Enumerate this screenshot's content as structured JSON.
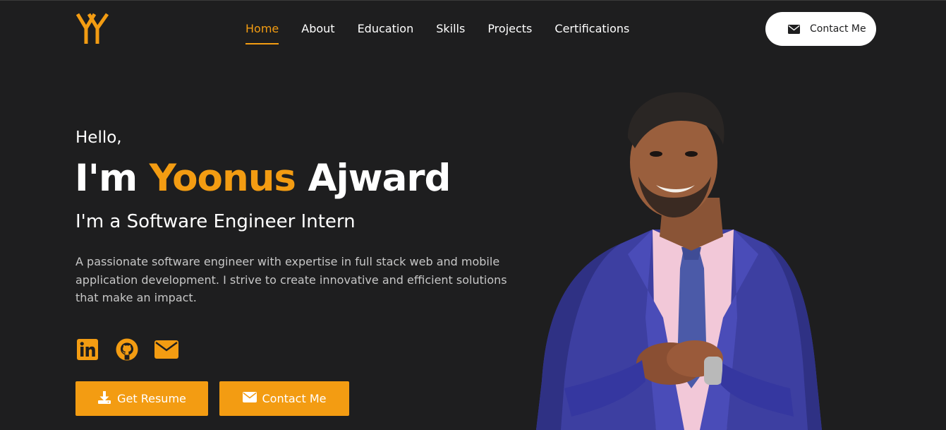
{
  "brand": {
    "logo_icon": "yy-monogram-logo-icon"
  },
  "nav": {
    "items": [
      {
        "label": "Home",
        "active": true
      },
      {
        "label": "About"
      },
      {
        "label": "Education"
      },
      {
        "label": "Skills"
      },
      {
        "label": "Projects"
      },
      {
        "label": "Certifications"
      }
    ],
    "contact_button": {
      "label": "Contact Me",
      "icon": "envelope-icon"
    }
  },
  "hero": {
    "greeting": "Hello,",
    "intro_prefix": "I'm",
    "first_name": "Yoonus",
    "last_name": "Ajward",
    "role": "I'm a Software Engineer Intern",
    "bio": "A passionate software engineer with expertise in full stack web and mobile application development. I strive to create innovative and efficient solutions that make an impact.",
    "socials": [
      {
        "icon": "linkedin-icon"
      },
      {
        "icon": "github-icon"
      },
      {
        "icon": "envelope-icon"
      }
    ],
    "buttons": {
      "resume": {
        "label": "Get Resume",
        "icon": "download-icon"
      },
      "contact": {
        "label": "Contact Me",
        "icon": "envelope-icon"
      }
    },
    "portrait": "person-in-blue-suit-photo"
  },
  "colors": {
    "background": "#1e1e1f",
    "accent": "#f39c12",
    "text": "#ffffff",
    "muted_text": "#c7c7c7",
    "button_light": "#ffffff"
  }
}
